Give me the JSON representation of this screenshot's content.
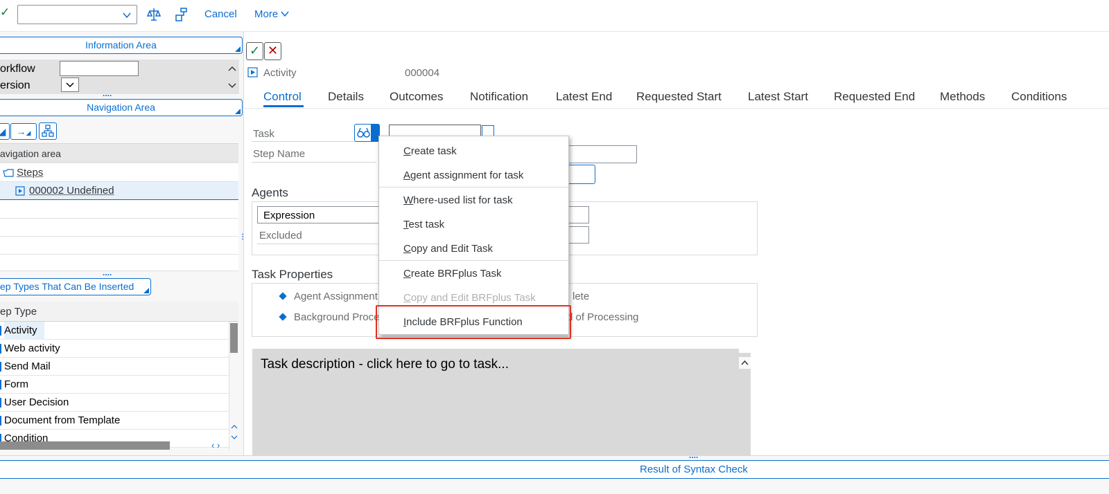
{
  "toolbar": {
    "cancel_label": "Cancel",
    "more_label": "More",
    "more_chevron": "⌵"
  },
  "left_panel": {
    "information_area": "Information Area",
    "workflow_label": "orkflow",
    "version_label": "ersion",
    "navigation_area": "Navigation Area",
    "nav_area_label": "avigation area",
    "tree": {
      "steps": "Steps",
      "item": "000002 Undefined"
    },
    "step_types_button": "ep Types That Can Be Inserted",
    "step_type_header": "ep Type",
    "step_types": [
      "Activity",
      "Web activity",
      "Send Mail",
      "Form",
      "User Decision",
      "Document from Template",
      "Condition"
    ]
  },
  "main": {
    "object_type": "Activity",
    "object_id": "000004",
    "tabs": [
      "Control",
      "Details",
      "Outcomes",
      "Notification",
      "Latest End",
      "Requested Start",
      "Latest Start",
      "Requested End",
      "Methods",
      "Conditions"
    ],
    "active_tab": "Control",
    "task_label": "Task",
    "step_name_label": "Step Name",
    "agents_title": "Agents",
    "expression_value": "Expression",
    "excluded_label": "Excluded",
    "task_properties_title": "Task Properties",
    "properties": [
      "Agent Assignment",
      "Background Proce",
      "lete",
      "d of Processing"
    ],
    "description": "Task description - click here to go to task..."
  },
  "context_menu": {
    "items": [
      {
        "label": "Create task",
        "enabled": true
      },
      {
        "label": "Agent assignment for task",
        "enabled": true
      },
      {
        "label": "Where-used list for task",
        "enabled": true
      },
      {
        "label": "Test task",
        "enabled": true
      },
      {
        "label": "Copy and Edit Task",
        "enabled": true
      },
      {
        "label": "Create BRFplus Task",
        "enabled": true
      },
      {
        "label": "Copy and Edit BRFplus Task",
        "enabled": false
      },
      {
        "label": "Include BRFplus Function",
        "enabled": true
      }
    ]
  },
  "status": {
    "result_label": "Result of Syntax Check"
  },
  "colors": {
    "accent": "#0a6ed1",
    "confirm": "#107e3e",
    "cancel": "#bb0000",
    "highlight_box": "#e0301e"
  }
}
